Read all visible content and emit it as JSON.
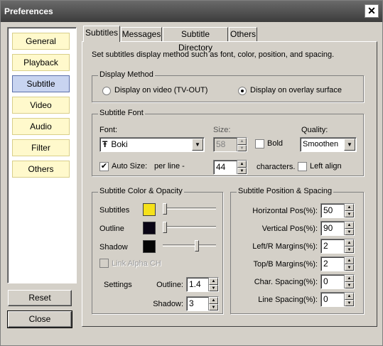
{
  "window": {
    "title": "Preferences"
  },
  "sidebar": {
    "items": [
      {
        "label": "General"
      },
      {
        "label": "Playback"
      },
      {
        "label": "Subtitle"
      },
      {
        "label": "Video"
      },
      {
        "label": "Audio"
      },
      {
        "label": "Filter"
      },
      {
        "label": "Others"
      }
    ],
    "active": "Subtitle"
  },
  "buttons": {
    "reset": "Reset",
    "close": "Close"
  },
  "tabs": [
    {
      "label": "Subtitles"
    },
    {
      "label": "Messages"
    },
    {
      "label": "Subtitle Directory"
    },
    {
      "label": "Others"
    }
  ],
  "description": "Set subtitles display method such as font, color, position, and spacing.",
  "display_method": {
    "title": "Display Method",
    "option_video": "Display on video (TV-OUT)",
    "option_overlay": "Display on overlay surface",
    "selected": "overlay"
  },
  "subtitle_font": {
    "title": "Subtitle Font",
    "font_label": "Font:",
    "font_value": "Boki",
    "font_icon_glyph": "Ŧ",
    "size_label": "Size:",
    "size_value": "58",
    "bold_label": "Bold",
    "bold_checked": false,
    "quality_label": "Quality:",
    "quality_value": "Smoothen",
    "auto_size_label": "Auto Size:",
    "auto_size_checked": true,
    "check_mark": "✔",
    "per_line_label": "per line -",
    "per_line_value": "44",
    "characters_label": "characters.",
    "left_align_label": "Left align",
    "left_align_checked": false
  },
  "color_opacity": {
    "title": "Subtitle Color & Opacity",
    "subtitles_label": "Subtitles",
    "subtitles_color": "#f5e11a",
    "subtitles_opacity": 0.0,
    "outline_label": "Outline",
    "outline_color": "#0a0515",
    "outline_opacity": 0.0,
    "shadow_label": "Shadow",
    "shadow_color": "#050505",
    "shadow_opacity": 0.65,
    "link_alpha_label": "Link Alpha CH",
    "settings_label": "Settings",
    "outline_size_label": "Outline:",
    "outline_size_value": "1.4",
    "shadow_size_label": "Shadow:",
    "shadow_size_value": "3"
  },
  "position_spacing": {
    "title": "Subtitle Position & Spacing",
    "rows": [
      {
        "label": "Horizontal Pos(%):",
        "value": "50"
      },
      {
        "label": "Vertical Pos(%):",
        "value": "90"
      },
      {
        "label": "Left/R Margins(%):",
        "value": "2"
      },
      {
        "label": "Top/B Margins(%):",
        "value": "2"
      },
      {
        "label": "Char. Spacing(%):",
        "value": "0"
      },
      {
        "label": "Line Spacing(%):",
        "value": "0"
      }
    ]
  },
  "glyphs": {
    "close": "✕",
    "down_arrow": "▼",
    "up": "▲",
    "down": "▼"
  }
}
